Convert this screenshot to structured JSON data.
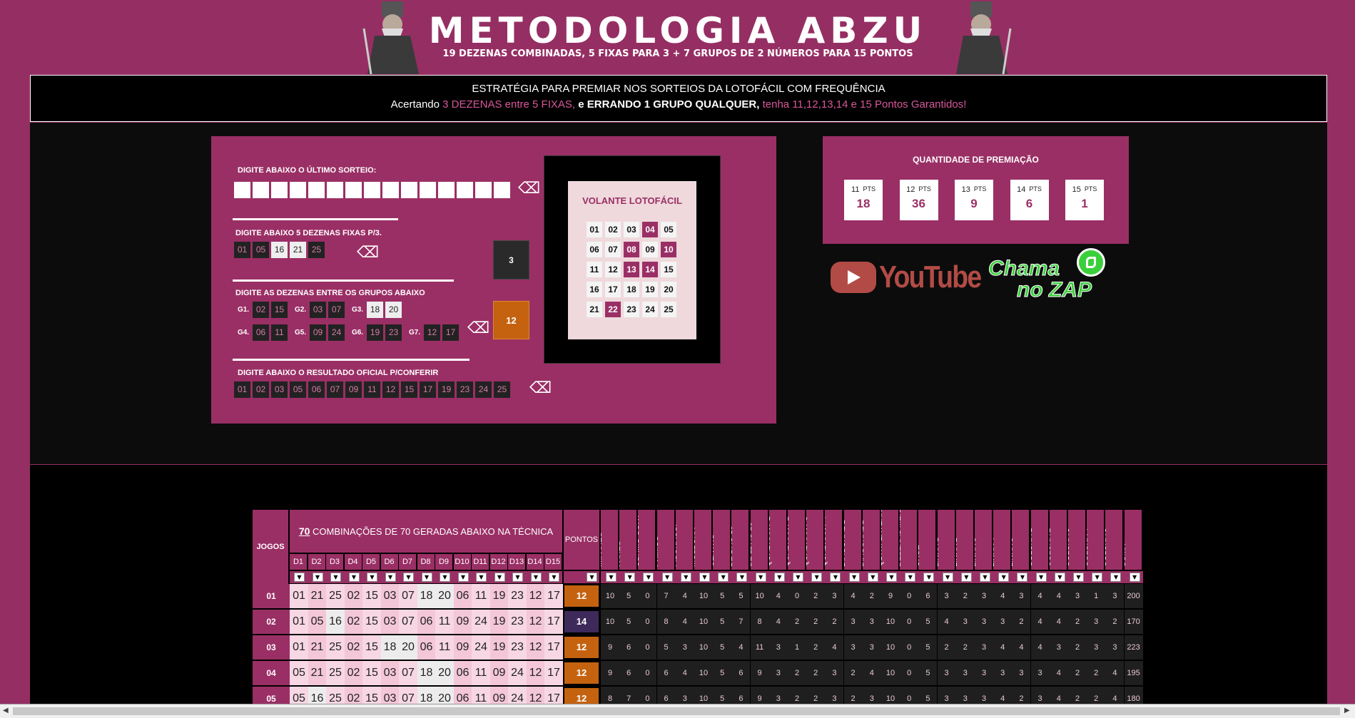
{
  "banner": {
    "title": "METODOLOGIA ABZU",
    "subtitle": "19 DEZENAS COMBINADAS, 5 FIXAS PARA 3 + 7 GRUPOS DE 2 NÚMEROS PARA 15 PONTOS"
  },
  "strategy": {
    "line1": "ESTRATÉGIA PARA PREMIAR NOS SORTEIOS DA LOTOFÁCIL COM FREQUÊNCIA",
    "line2_a": "Acertando ",
    "line2_b": "3 DEZENAS entre 5 FIXAS,",
    "line2_c": " e ERRANDO 1 GRUPO QUALQUER,",
    "line2_d": " tenha 11,12,13,14 e 15 Pontos Garantidos!"
  },
  "panel": {
    "last_draw_label": "DIGITE ABAIXO O ÚLTIMO SORTEIO:",
    "fixed_label": "DIGITE ABAIXO 5 DEZENAS FIXAS P/3.",
    "fixed": [
      "01",
      "05",
      "16",
      "21",
      "25"
    ],
    "fixed_count": "3",
    "groups_label": "DIGITE AS DEZENAS ENTRE OS GRUPOS ABAIXO",
    "groups": [
      {
        "name": "G1.",
        "nums": [
          "02",
          "15"
        ]
      },
      {
        "name": "G2.",
        "nums": [
          "03",
          "07"
        ]
      },
      {
        "name": "G3.",
        "nums": [
          "18",
          "20"
        ]
      },
      {
        "name": "G4.",
        "nums": [
          "06",
          "11"
        ]
      },
      {
        "name": "G5.",
        "nums": [
          "09",
          "24"
        ]
      },
      {
        "name": "G6.",
        "nums": [
          "19",
          "23"
        ]
      },
      {
        "name": "G7.",
        "nums": [
          "12",
          "17"
        ]
      }
    ],
    "groups_count": "12",
    "result_label": "DIGITE ABAIXO O RESULTADO OFICIAL P/CONFERIR",
    "result": [
      "01",
      "02",
      "03",
      "05",
      "06",
      "07",
      "09",
      "11",
      "12",
      "15",
      "17",
      "19",
      "23",
      "24",
      "25"
    ]
  },
  "volante": {
    "title": "VOLANTE LOTOFÁCIL",
    "numbers": [
      "01",
      "02",
      "03",
      "04",
      "05",
      "06",
      "07",
      "08",
      "09",
      "10",
      "11",
      "12",
      "13",
      "14",
      "15",
      "16",
      "17",
      "18",
      "19",
      "20",
      "21",
      "22",
      "23",
      "24",
      "25"
    ],
    "selected": [
      "04",
      "08",
      "10",
      "13",
      "14",
      "22"
    ]
  },
  "premiacao": {
    "title": "QUANTIDADE DE PREMIAÇÃO",
    "pts_label": "PTS",
    "items": [
      {
        "pts": "11",
        "qty": "18"
      },
      {
        "pts": "12",
        "qty": "36"
      },
      {
        "pts": "13",
        "qty": "9"
      },
      {
        "pts": "14",
        "qty": "6"
      },
      {
        "pts": "15",
        "qty": "1"
      }
    ]
  },
  "links": {
    "youtube": "YouTube",
    "zap_line1": "Chama",
    "zap_line2": "no ZAP"
  },
  "table": {
    "jogos_header": "JOGOS",
    "combo_count": "70",
    "combo_header": " COMBINAÇÕES DE 70 GERADAS ABAIXO NA TÉCNICA",
    "pontos_header": "PONTOS",
    "d_headers": [
      "D1",
      "D2",
      "D3",
      "D4",
      "D5",
      "D6",
      "D7",
      "D8",
      "D9",
      "D10",
      "D11",
      "D12",
      "D13",
      "D14",
      "D15"
    ],
    "stat_headers": [
      "ÍMPARES",
      "PARES",
      "ÚLTIMO SORT",
      "PRIMOS",
      "FIBONACCI",
      "MOLDURA",
      "CENTRO",
      "DZ 1 AO 10",
      "DZ 11 AO 25",
      "QUADRANT 1",
      "QUADRANT 2",
      "QUADRANT 3",
      "QUADRANT 4",
      "DIAGONAL 1",
      "DIAGONAL 2",
      "QDRT. EXTERN",
      "DEZENAS MEIO",
      "CRUZ",
      "LINHA 1",
      "LINHA 2",
      "LINHA 3",
      "LINHA 4",
      "LINHA 5",
      "COLUNA 1",
      "COLUNA 2",
      "COLUNA 3",
      "COLUNA 4",
      "COLUNA 5",
      "SOMA"
    ],
    "rows": [
      {
        "jogo": "01",
        "d": [
          "01",
          "21",
          "25",
          "02",
          "15",
          "03",
          "07",
          "18",
          "20",
          "06",
          "11",
          "19",
          "23",
          "12",
          "17"
        ],
        "pontos": "12",
        "stats": [
          "10",
          "5",
          "0",
          "7",
          "4",
          "10",
          "5",
          "5",
          "10",
          "4",
          "0",
          "2",
          "3",
          "4",
          "2",
          "9",
          "0",
          "6",
          "3",
          "2",
          "3",
          "4",
          "3",
          "4",
          "4",
          "3",
          "1",
          "3",
          "200"
        ]
      },
      {
        "jogo": "02",
        "d": [
          "01",
          "05",
          "16",
          "02",
          "15",
          "03",
          "07",
          "06",
          "11",
          "09",
          "24",
          "19",
          "23",
          "12",
          "17"
        ],
        "pontos": "14",
        "stats": [
          "10",
          "5",
          "0",
          "8",
          "4",
          "10",
          "5",
          "7",
          "8",
          "4",
          "2",
          "2",
          "2",
          "3",
          "3",
          "10",
          "0",
          "5",
          "4",
          "3",
          "3",
          "3",
          "2",
          "4",
          "4",
          "2",
          "3",
          "2",
          "170"
        ]
      },
      {
        "jogo": "03",
        "d": [
          "01",
          "21",
          "25",
          "02",
          "15",
          "18",
          "20",
          "06",
          "11",
          "09",
          "24",
          "19",
          "23",
          "12",
          "17"
        ],
        "pontos": "12",
        "stats": [
          "9",
          "6",
          "0",
          "5",
          "3",
          "10",
          "5",
          "4",
          "11",
          "3",
          "1",
          "2",
          "4",
          "3",
          "3",
          "10",
          "0",
          "5",
          "2",
          "2",
          "3",
          "4",
          "4",
          "4",
          "3",
          "2",
          "3",
          "3",
          "223"
        ]
      },
      {
        "jogo": "04",
        "d": [
          "05",
          "21",
          "25",
          "02",
          "15",
          "03",
          "07",
          "18",
          "20",
          "06",
          "11",
          "09",
          "24",
          "12",
          "17"
        ],
        "pontos": "12",
        "stats": [
          "9",
          "6",
          "0",
          "6",
          "4",
          "10",
          "5",
          "6",
          "9",
          "3",
          "2",
          "2",
          "3",
          "2",
          "4",
          "10",
          "0",
          "5",
          "3",
          "3",
          "3",
          "3",
          "3",
          "3",
          "4",
          "2",
          "2",
          "4",
          "195"
        ]
      },
      {
        "jogo": "05",
        "d": [
          "05",
          "16",
          "25",
          "02",
          "15",
          "03",
          "07",
          "18",
          "20",
          "06",
          "11",
          "09",
          "24",
          "12",
          "17"
        ],
        "pontos": "12",
        "stats": [
          "8",
          "7",
          "0",
          "6",
          "3",
          "10",
          "5",
          "6",
          "9",
          "3",
          "2",
          "2",
          "3",
          "2",
          "3",
          "10",
          "0",
          "5",
          "3",
          "3",
          "3",
          "4",
          "2",
          "3",
          "4",
          "2",
          "2",
          "4",
          "180"
        ]
      }
    ]
  }
}
